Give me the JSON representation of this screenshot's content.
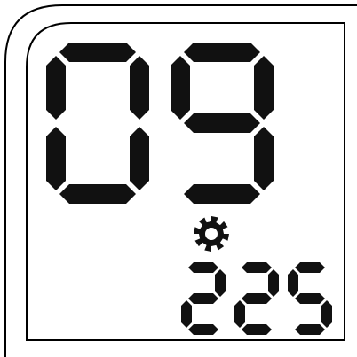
{
  "display": {
    "primary_value": "09",
    "secondary_value": "225",
    "mode_icon": "gear-icon",
    "segment_color": "#111111",
    "background_color": "#ffffff",
    "frame_color": "#000000"
  }
}
